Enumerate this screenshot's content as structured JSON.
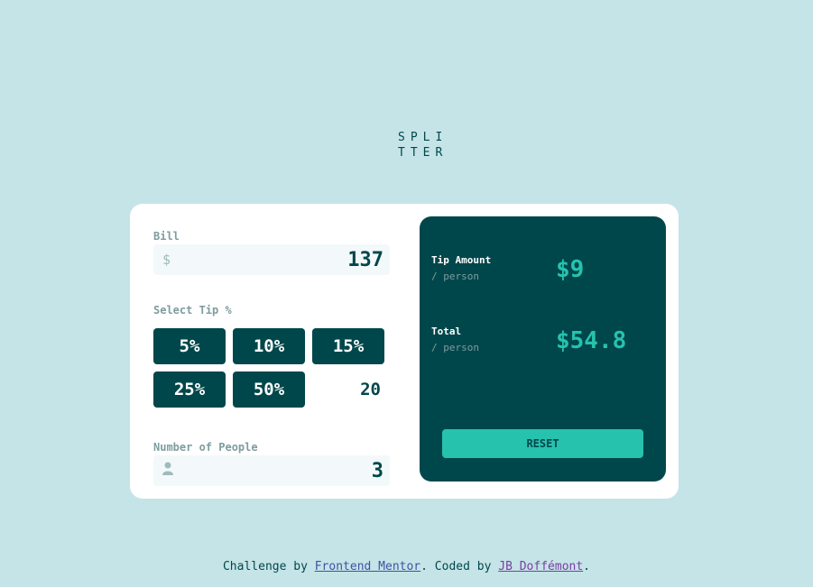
{
  "logo": {
    "line1": "SPLI",
    "line2": "TTER"
  },
  "bill": {
    "label": "Bill",
    "icon": "dollar-icon",
    "currency_symbol": "$",
    "value": "137"
  },
  "tip": {
    "label": "Select Tip %",
    "options": [
      "5%",
      "10%",
      "15%",
      "25%",
      "50%"
    ],
    "custom_value": "20"
  },
  "people": {
    "label": "Number of People",
    "icon": "person-icon",
    "value": "3"
  },
  "result": {
    "tip_title": "Tip Amount",
    "tip_sub": "/ person",
    "tip_value": "$9",
    "total_title": "Total",
    "total_sub": "/ person",
    "total_value": "$54.8",
    "reset_label": "RESET"
  },
  "attribution": {
    "prefix": "Challenge by",
    "link1": "Frontend Mentor",
    "middle": ". Coded by",
    "link2": "JB Doffémont",
    "suffix": "."
  },
  "colors": {
    "background": "#c5e4e7",
    "dark_cyan": "#00474b",
    "strong_cyan": "#26c2ae",
    "grayish_cyan": "#7f9c9f",
    "field_bg": "#f3f9fa"
  }
}
